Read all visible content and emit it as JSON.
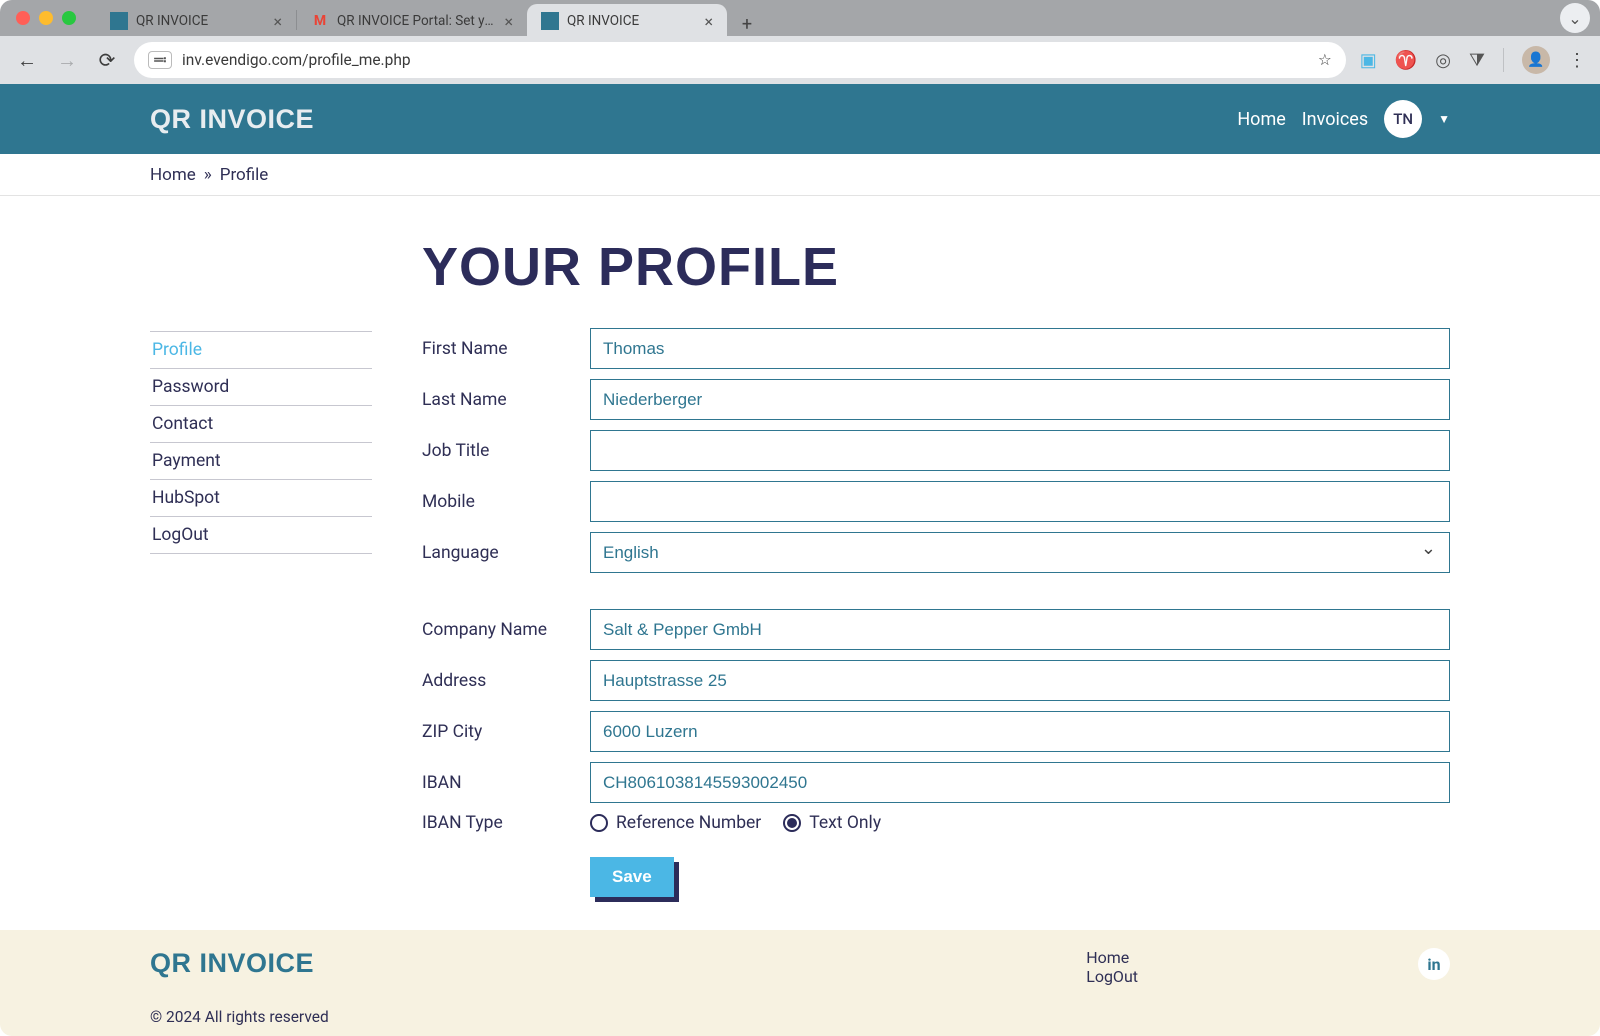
{
  "browser": {
    "tabs": [
      {
        "title": "QR INVOICE",
        "favicon": "teal"
      },
      {
        "title": "QR INVOICE Portal: Set your f",
        "favicon": "gmail"
      },
      {
        "title": "QR INVOICE",
        "favicon": "teal",
        "active": true
      }
    ],
    "url": "inv.evendigo.com/profile_me.php"
  },
  "header": {
    "brand": "QR INVOICE",
    "nav": {
      "home": "Home",
      "invoices": "Invoices"
    },
    "avatar": "TN"
  },
  "breadcrumb": {
    "home": "Home",
    "sep": "»",
    "current": "Profile"
  },
  "page": {
    "title": "YOUR PROFILE"
  },
  "sidebar": {
    "items": [
      {
        "label": "Profile",
        "active": true
      },
      {
        "label": "Password"
      },
      {
        "label": "Contact"
      },
      {
        "label": "Payment"
      },
      {
        "label": "HubSpot"
      },
      {
        "label": "LogOut"
      }
    ]
  },
  "form": {
    "labels": {
      "first_name": "First Name",
      "last_name": "Last Name",
      "job_title": "Job Title",
      "mobile": "Mobile",
      "language": "Language",
      "company_name": "Company Name",
      "address": "Address",
      "zip_city": "ZIP City",
      "iban": "IBAN",
      "iban_type": "IBAN Type"
    },
    "values": {
      "first_name": "Thomas",
      "last_name": "Niederberger",
      "job_title": "",
      "mobile": "",
      "language": "English",
      "company_name": "Salt & Pepper GmbH",
      "address": "Hauptstrasse 25",
      "zip_city": "6000 Luzern",
      "iban": "CH8061038145593002450"
    },
    "iban_type": {
      "reference_number": "Reference Number",
      "text_only": "Text Only",
      "selected": "text_only"
    },
    "save": "Save"
  },
  "footer": {
    "brand": "QR INVOICE",
    "links": {
      "home": "Home",
      "logout": "LogOut"
    },
    "linkedin": "in",
    "copyright": "© 2024 All rights reserved"
  }
}
